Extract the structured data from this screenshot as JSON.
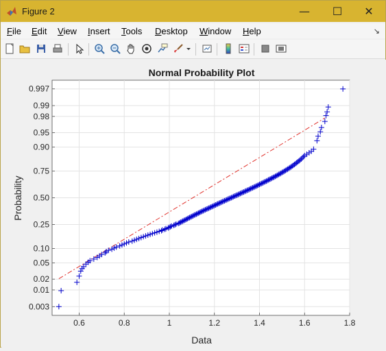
{
  "window": {
    "title": "Figure 2",
    "minimize_glyph": "—",
    "maximize_glyph": "☐",
    "close_glyph": "✕",
    "accent": "#d8b430"
  },
  "menubar": {
    "items": [
      {
        "label": "File",
        "mnemonic": "F",
        "rest": "ile"
      },
      {
        "label": "Edit",
        "mnemonic": "E",
        "rest": "dit"
      },
      {
        "label": "View",
        "mnemonic": "V",
        "rest": "iew"
      },
      {
        "label": "Insert",
        "mnemonic": "I",
        "rest": "nsert"
      },
      {
        "label": "Tools",
        "mnemonic": "T",
        "rest": "ools"
      },
      {
        "label": "Desktop",
        "mnemonic": "D",
        "rest": "esktop"
      },
      {
        "label": "Window",
        "mnemonic": "W",
        "rest": "indow"
      },
      {
        "label": "Help",
        "mnemonic": "H",
        "rest": "elp"
      }
    ],
    "dock_glyph": "↘"
  },
  "toolbar": {
    "icons": [
      "new-figure-icon",
      "open-file-icon",
      "save-icon",
      "print-icon",
      "pointer-icon",
      "zoom-in-icon",
      "zoom-out-icon",
      "pan-hand-icon",
      "rotate-3d-icon",
      "data-cursor-icon",
      "brush-icon",
      "brush-dropdown-icon",
      "link-plot-icon",
      "colorbar-icon",
      "legend-icon",
      "hide-plot-tools-icon",
      "show-plot-tools-icon"
    ]
  },
  "chart_data": {
    "type": "scatter",
    "title": "Normal Probability Plot",
    "xlabel": "Data",
    "ylabel": "Probability",
    "xlim": [
      0.48,
      1.8
    ],
    "xticks": [
      0.6,
      0.8,
      1,
      1.2,
      1.4,
      1.6,
      1.8
    ],
    "xtick_labels": [
      "0.6",
      "0.8",
      "1",
      "1.2",
      "1.4",
      "1.6",
      "1.8"
    ],
    "yscale": "normal-probability",
    "yticks": [
      0.003,
      0.01,
      0.02,
      0.05,
      0.1,
      0.25,
      0.5,
      0.75,
      0.9,
      0.95,
      0.98,
      0.99,
      0.997
    ],
    "ytick_labels": [
      "0.003",
      "0.01",
      "0.02",
      "0.05",
      "0.10",
      "0.25",
      "0.50",
      "0.75",
      "0.90",
      "0.95",
      "0.98",
      "0.99",
      "0.997"
    ],
    "grid": true,
    "marker": "+",
    "marker_color": "#0000cc",
    "reference_line": {
      "style": "dash-dot",
      "color": "#e0302a",
      "x": [
        0.51,
        1.69
      ],
      "y": [
        0.0205,
        0.978
      ]
    },
    "points": [
      [
        0.51,
        0.003
      ],
      [
        0.52,
        0.0095
      ],
      [
        0.59,
        0.0165
      ],
      [
        0.6,
        0.024
      ],
      [
        0.607,
        0.032
      ],
      [
        0.613,
        0.037
      ],
      [
        0.62,
        0.041
      ],
      [
        0.63,
        0.047
      ],
      [
        0.64,
        0.052
      ],
      [
        0.648,
        0.056
      ],
      [
        0.665,
        0.061
      ],
      [
        0.68,
        0.066
      ],
      [
        0.69,
        0.071
      ],
      [
        0.7,
        0.076
      ],
      [
        0.715,
        0.082
      ],
      [
        0.72,
        0.087
      ],
      [
        0.73,
        0.092
      ],
      [
        0.745,
        0.097
      ],
      [
        0.755,
        0.102
      ],
      [
        0.765,
        0.107
      ],
      [
        0.78,
        0.112
      ],
      [
        0.79,
        0.117
      ],
      [
        0.8,
        0.122
      ],
      [
        0.81,
        0.127
      ],
      [
        0.82,
        0.132
      ],
      [
        0.835,
        0.137
      ],
      [
        0.845,
        0.142
      ],
      [
        0.855,
        0.147
      ],
      [
        0.865,
        0.152
      ],
      [
        0.875,
        0.158
      ],
      [
        0.885,
        0.163
      ],
      [
        0.895,
        0.168
      ],
      [
        0.905,
        0.173
      ],
      [
        0.915,
        0.178
      ],
      [
        0.925,
        0.183
      ],
      [
        0.935,
        0.188
      ],
      [
        0.945,
        0.193
      ],
      [
        0.955,
        0.198
      ],
      [
        0.965,
        0.203
      ],
      [
        0.97,
        0.208
      ],
      [
        0.98,
        0.213
      ],
      [
        0.985,
        0.218
      ],
      [
        0.995,
        0.223
      ],
      [
        1.0,
        0.228
      ],
      [
        1.005,
        0.233
      ],
      [
        1.01,
        0.238
      ],
      [
        1.02,
        0.243
      ],
      [
        1.025,
        0.248
      ],
      [
        1.03,
        0.253
      ],
      [
        1.04,
        0.258
      ],
      [
        1.045,
        0.263
      ],
      [
        1.05,
        0.268
      ],
      [
        1.055,
        0.273
      ],
      [
        1.06,
        0.278
      ],
      [
        1.065,
        0.283
      ],
      [
        1.07,
        0.288
      ],
      [
        1.075,
        0.293
      ],
      [
        1.08,
        0.298
      ],
      [
        1.085,
        0.304
      ],
      [
        1.09,
        0.309
      ],
      [
        1.095,
        0.314
      ],
      [
        1.1,
        0.319
      ],
      [
        1.105,
        0.324
      ],
      [
        1.11,
        0.33
      ],
      [
        1.115,
        0.335
      ],
      [
        1.12,
        0.34
      ],
      [
        1.125,
        0.345
      ],
      [
        1.13,
        0.35
      ],
      [
        1.135,
        0.356
      ],
      [
        1.14,
        0.361
      ],
      [
        1.145,
        0.366
      ],
      [
        1.15,
        0.371
      ],
      [
        1.155,
        0.377
      ],
      [
        1.16,
        0.382
      ],
      [
        1.165,
        0.387
      ],
      [
        1.17,
        0.392
      ],
      [
        1.175,
        0.397
      ],
      [
        1.18,
        0.402
      ],
      [
        1.185,
        0.408
      ],
      [
        1.19,
        0.413
      ],
      [
        1.195,
        0.418
      ],
      [
        1.2,
        0.423
      ],
      [
        1.205,
        0.428
      ],
      [
        1.21,
        0.434
      ],
      [
        1.215,
        0.439
      ],
      [
        1.22,
        0.444
      ],
      [
        1.225,
        0.449
      ],
      [
        1.23,
        0.454
      ],
      [
        1.235,
        0.46
      ],
      [
        1.24,
        0.465
      ],
      [
        1.245,
        0.47
      ],
      [
        1.25,
        0.475
      ],
      [
        1.255,
        0.48
      ],
      [
        1.26,
        0.486
      ],
      [
        1.265,
        0.491
      ],
      [
        1.27,
        0.496
      ],
      [
        1.275,
        0.501
      ],
      [
        1.28,
        0.506
      ],
      [
        1.285,
        0.512
      ],
      [
        1.29,
        0.517
      ],
      [
        1.295,
        0.522
      ],
      [
        1.3,
        0.527
      ],
      [
        1.305,
        0.532
      ],
      [
        1.31,
        0.538
      ],
      [
        1.315,
        0.543
      ],
      [
        1.32,
        0.548
      ],
      [
        1.325,
        0.553
      ],
      [
        1.33,
        0.558
      ],
      [
        1.335,
        0.564
      ],
      [
        1.34,
        0.569
      ],
      [
        1.345,
        0.574
      ],
      [
        1.35,
        0.579
      ],
      [
        1.355,
        0.584
      ],
      [
        1.36,
        0.59
      ],
      [
        1.365,
        0.595
      ],
      [
        1.37,
        0.6
      ],
      [
        1.375,
        0.605
      ],
      [
        1.38,
        0.611
      ],
      [
        1.385,
        0.616
      ],
      [
        1.39,
        0.621
      ],
      [
        1.395,
        0.626
      ],
      [
        1.4,
        0.632
      ],
      [
        1.405,
        0.637
      ],
      [
        1.41,
        0.642
      ],
      [
        1.415,
        0.647
      ],
      [
        1.42,
        0.653
      ],
      [
        1.425,
        0.658
      ],
      [
        1.43,
        0.663
      ],
      [
        1.435,
        0.668
      ],
      [
        1.44,
        0.674
      ],
      [
        1.445,
        0.679
      ],
      [
        1.45,
        0.684
      ],
      [
        1.455,
        0.69
      ],
      [
        1.46,
        0.695
      ],
      [
        1.465,
        0.7
      ],
      [
        1.47,
        0.706
      ],
      [
        1.475,
        0.711
      ],
      [
        1.48,
        0.716
      ],
      [
        1.485,
        0.722
      ],
      [
        1.49,
        0.727
      ],
      [
        1.495,
        0.732
      ],
      [
        1.5,
        0.738
      ],
      [
        1.505,
        0.743
      ],
      [
        1.51,
        0.749
      ],
      [
        1.515,
        0.754
      ],
      [
        1.52,
        0.76
      ],
      [
        1.525,
        0.765
      ],
      [
        1.53,
        0.771
      ],
      [
        1.535,
        0.777
      ],
      [
        1.54,
        0.782
      ],
      [
        1.545,
        0.788
      ],
      [
        1.55,
        0.794
      ],
      [
        1.555,
        0.8
      ],
      [
        1.56,
        0.806
      ],
      [
        1.565,
        0.812
      ],
      [
        1.57,
        0.818
      ],
      [
        1.575,
        0.824
      ],
      [
        1.58,
        0.83
      ],
      [
        1.585,
        0.836
      ],
      [
        1.59,
        0.843
      ],
      [
        1.595,
        0.85
      ],
      [
        1.6,
        0.857
      ],
      [
        1.61,
        0.864
      ],
      [
        1.62,
        0.872
      ],
      [
        1.63,
        0.88
      ],
      [
        1.64,
        0.89
      ],
      [
        1.655,
        0.925
      ],
      [
        1.66,
        0.94
      ],
      [
        1.67,
        0.952
      ],
      [
        1.675,
        0.962
      ],
      [
        1.69,
        0.973
      ],
      [
        1.695,
        0.981
      ],
      [
        1.7,
        0.985
      ],
      [
        1.705,
        0.989
      ],
      [
        1.77,
        0.997
      ]
    ]
  }
}
